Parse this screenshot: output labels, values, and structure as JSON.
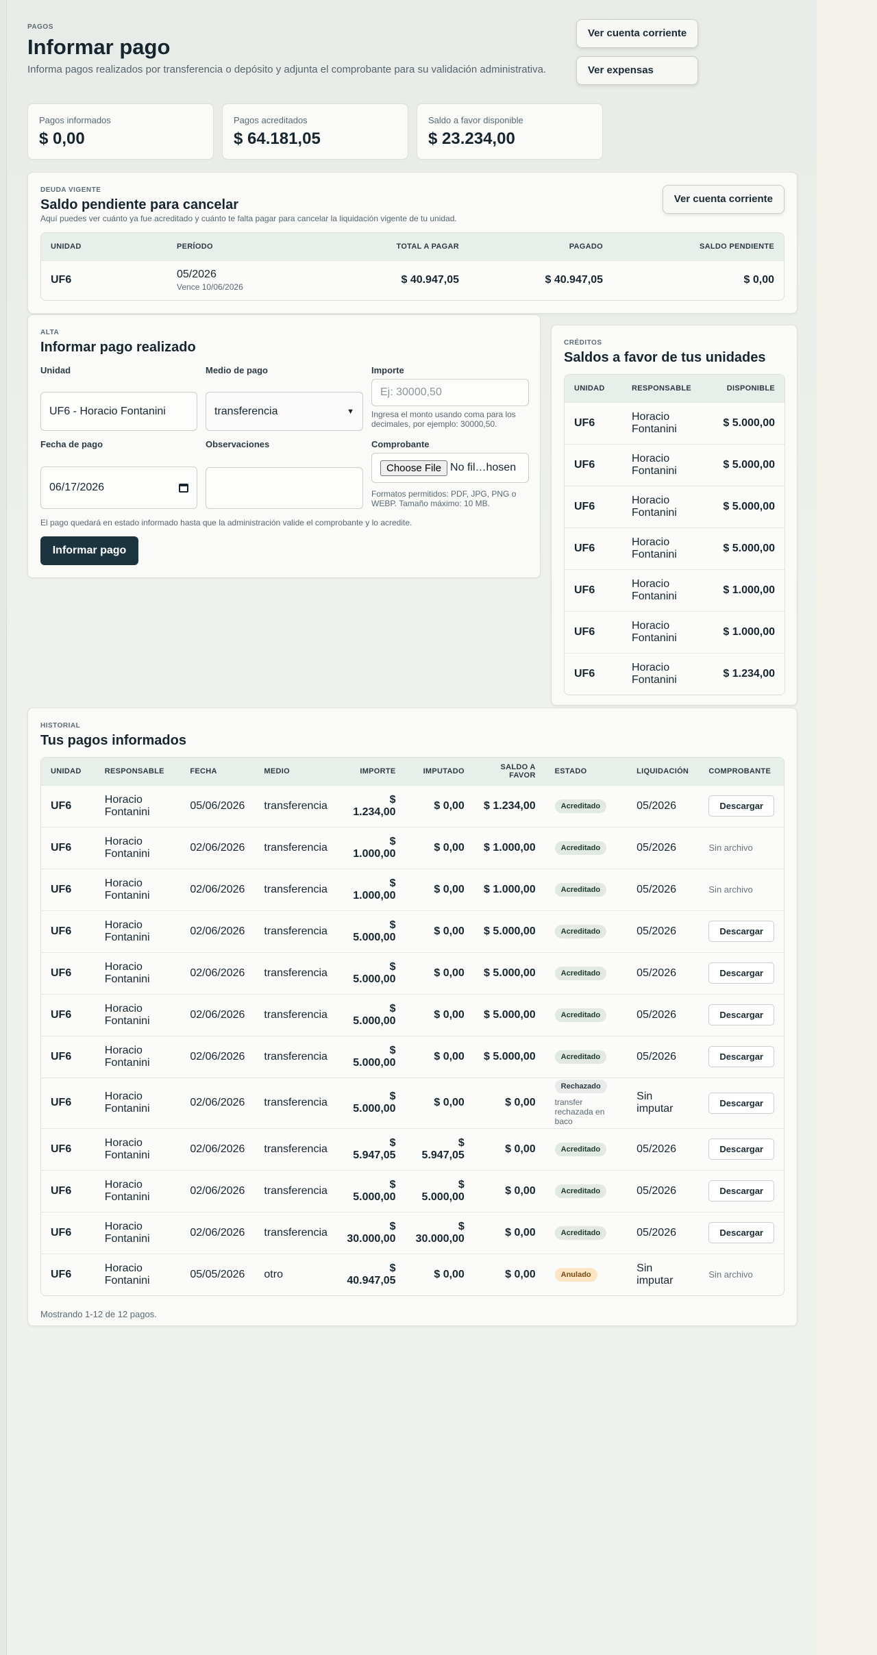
{
  "header": {
    "eyebrow": "PAGOS",
    "title": "Informar pago",
    "description": "Informa pagos realizados por transferencia o depósito y adjunta el comprobante para su validación administrativa.",
    "btn_account": "Ver cuenta corriente",
    "btn_expenses": "Ver expensas"
  },
  "stats": [
    {
      "label": "Pagos informados",
      "value": "$ 0,00"
    },
    {
      "label": "Pagos acreditados",
      "value": "$ 64.181,05"
    },
    {
      "label": "Saldo a favor disponible",
      "value": "$ 23.234,00"
    }
  ],
  "debt": {
    "eyebrow": "DEUDA VIGENTE",
    "title": "Saldo pendiente para cancelar",
    "description": "Aquí puedes ver cuánto ya fue acreditado y cuánto te falta pagar para cancelar la liquidación vigente de tu unidad.",
    "button": "Ver cuenta corriente",
    "columns": [
      "Unidad",
      "Período",
      "Total a pagar",
      "Pagado",
      "Saldo pendiente"
    ],
    "row": {
      "unit": "UF6",
      "period": "05/2026",
      "due": "Vence 10/06/2026",
      "total": "$ 40.947,05",
      "paid": "$ 40.947,05",
      "pending": "$ 0,00"
    }
  },
  "form": {
    "eyebrow": "ALTA",
    "title": "Informar pago realizado",
    "unit_label": "Unidad",
    "unit_value": "UF6 - Horacio Fontanini",
    "method_label": "Medio de pago",
    "method_value": "transferencia",
    "amount_label": "Importe",
    "amount_placeholder": "Ej: 30000,50",
    "amount_hint": "Ingresa el monto usando coma para los decimales, por ejemplo: 30000,50.",
    "date_label": "Fecha de pago",
    "date_value": "06/17/2026",
    "obs_label": "Observaciones",
    "receipt_label": "Comprobante",
    "choose_file": "Choose File",
    "no_file": "No fil…hosen",
    "receipt_hint": "Formatos permitidos: PDF, JPG, PNG o WEBP. Tamaño máximo: 10 MB.",
    "note": "El pago quedará en estado informado hasta que la administración valide el comprobante y lo acredite.",
    "submit": "Informar pago"
  },
  "credits": {
    "eyebrow": "CRÉDITOS",
    "title": "Saldos a favor de tus unidades",
    "columns": [
      "Unidad",
      "Responsable",
      "Disponible"
    ],
    "rows": [
      {
        "unit": "UF6",
        "resp": "Horacio Fontanini",
        "avail": "$ 5.000,00"
      },
      {
        "unit": "UF6",
        "resp": "Horacio Fontanini",
        "avail": "$ 5.000,00"
      },
      {
        "unit": "UF6",
        "resp": "Horacio Fontanini",
        "avail": "$ 5.000,00"
      },
      {
        "unit": "UF6",
        "resp": "Horacio Fontanini",
        "avail": "$ 5.000,00"
      },
      {
        "unit": "UF6",
        "resp": "Horacio Fontanini",
        "avail": "$ 1.000,00"
      },
      {
        "unit": "UF6",
        "resp": "Horacio Fontanini",
        "avail": "$ 1.000,00"
      },
      {
        "unit": "UF6",
        "resp": "Horacio Fontanini",
        "avail": "$ 1.234,00"
      }
    ]
  },
  "history": {
    "eyebrow": "HISTORIAL",
    "title": "Tus pagos informados",
    "columns": [
      "Unidad",
      "Responsable",
      "Fecha",
      "Medio",
      "Importe",
      "Imputado",
      "Saldo a favor",
      "Estado",
      "Liquidación",
      "Comprobante"
    ],
    "rows": [
      {
        "unit": "UF6",
        "resp": "Horacio Fontanini",
        "date": "05/06/2026",
        "method": "transferencia",
        "amount": "$ 1.234,00",
        "imputed": "$ 0,00",
        "credit": "$ 1.234,00",
        "status": "Acreditado",
        "status_kind": "ok",
        "status_note": "",
        "liq": "05/2026",
        "receipt": "Descargar",
        "receipt_kind": "button"
      },
      {
        "unit": "UF6",
        "resp": "Horacio Fontanini",
        "date": "02/06/2026",
        "method": "transferencia",
        "amount": "$ 1.000,00",
        "imputed": "$ 0,00",
        "credit": "$ 1.000,00",
        "status": "Acreditado",
        "status_kind": "ok",
        "status_note": "",
        "liq": "05/2026",
        "receipt": "Sin archivo",
        "receipt_kind": "text"
      },
      {
        "unit": "UF6",
        "resp": "Horacio Fontanini",
        "date": "02/06/2026",
        "method": "transferencia",
        "amount": "$ 1.000,00",
        "imputed": "$ 0,00",
        "credit": "$ 1.000,00",
        "status": "Acreditado",
        "status_kind": "ok",
        "status_note": "",
        "liq": "05/2026",
        "receipt": "Sin archivo",
        "receipt_kind": "text"
      },
      {
        "unit": "UF6",
        "resp": "Horacio Fontanini",
        "date": "02/06/2026",
        "method": "transferencia",
        "amount": "$ 5.000,00",
        "imputed": "$ 0,00",
        "credit": "$ 5.000,00",
        "status": "Acreditado",
        "status_kind": "ok",
        "status_note": "",
        "liq": "05/2026",
        "receipt": "Descargar",
        "receipt_kind": "button"
      },
      {
        "unit": "UF6",
        "resp": "Horacio Fontanini",
        "date": "02/06/2026",
        "method": "transferencia",
        "amount": "$ 5.000,00",
        "imputed": "$ 0,00",
        "credit": "$ 5.000,00",
        "status": "Acreditado",
        "status_kind": "ok",
        "status_note": "",
        "liq": "05/2026",
        "receipt": "Descargar",
        "receipt_kind": "button"
      },
      {
        "unit": "UF6",
        "resp": "Horacio Fontanini",
        "date": "02/06/2026",
        "method": "transferencia",
        "amount": "$ 5.000,00",
        "imputed": "$ 0,00",
        "credit": "$ 5.000,00",
        "status": "Acreditado",
        "status_kind": "ok",
        "status_note": "",
        "liq": "05/2026",
        "receipt": "Descargar",
        "receipt_kind": "button"
      },
      {
        "unit": "UF6",
        "resp": "Horacio Fontanini",
        "date": "02/06/2026",
        "method": "transferencia",
        "amount": "$ 5.000,00",
        "imputed": "$ 0,00",
        "credit": "$ 5.000,00",
        "status": "Acreditado",
        "status_kind": "ok",
        "status_note": "",
        "liq": "05/2026",
        "receipt": "Descargar",
        "receipt_kind": "button"
      },
      {
        "unit": "UF6",
        "resp": "Horacio Fontanini",
        "date": "02/06/2026",
        "method": "transferencia",
        "amount": "$ 5.000,00",
        "imputed": "$ 0,00",
        "credit": "$ 0,00",
        "status": "Rechazado",
        "status_kind": "rej",
        "status_note": "transfer rechazada en baco",
        "liq": "Sin imputar",
        "receipt": "Descargar",
        "receipt_kind": "button"
      },
      {
        "unit": "UF6",
        "resp": "Horacio Fontanini",
        "date": "02/06/2026",
        "method": "transferencia",
        "amount": "$ 5.947,05",
        "imputed": "$ 5.947,05",
        "credit": "$ 0,00",
        "status": "Acreditado",
        "status_kind": "ok",
        "status_note": "",
        "liq": "05/2026",
        "receipt": "Descargar",
        "receipt_kind": "button"
      },
      {
        "unit": "UF6",
        "resp": "Horacio Fontanini",
        "date": "02/06/2026",
        "method": "transferencia",
        "amount": "$ 5.000,00",
        "imputed": "$ 5.000,00",
        "credit": "$ 0,00",
        "status": "Acreditado",
        "status_kind": "ok",
        "status_note": "",
        "liq": "05/2026",
        "receipt": "Descargar",
        "receipt_kind": "button"
      },
      {
        "unit": "UF6",
        "resp": "Horacio Fontanini",
        "date": "02/06/2026",
        "method": "transferencia",
        "amount": "$ 30.000,00",
        "imputed": "$ 30.000,00",
        "credit": "$ 0,00",
        "status": "Acreditado",
        "status_kind": "ok",
        "status_note": "",
        "liq": "05/2026",
        "receipt": "Descargar",
        "receipt_kind": "button"
      },
      {
        "unit": "UF6",
        "resp": "Horacio Fontanini",
        "date": "05/05/2026",
        "method": "otro",
        "amount": "$ 40.947,05",
        "imputed": "$ 0,00",
        "credit": "$ 0,00",
        "status": "Anulado",
        "status_kind": "anu",
        "status_note": "",
        "liq": "Sin imputar",
        "receipt": "Sin archivo",
        "receipt_kind": "text"
      }
    ],
    "footer": "Mostrando 1-12 de 12 pagos."
  }
}
